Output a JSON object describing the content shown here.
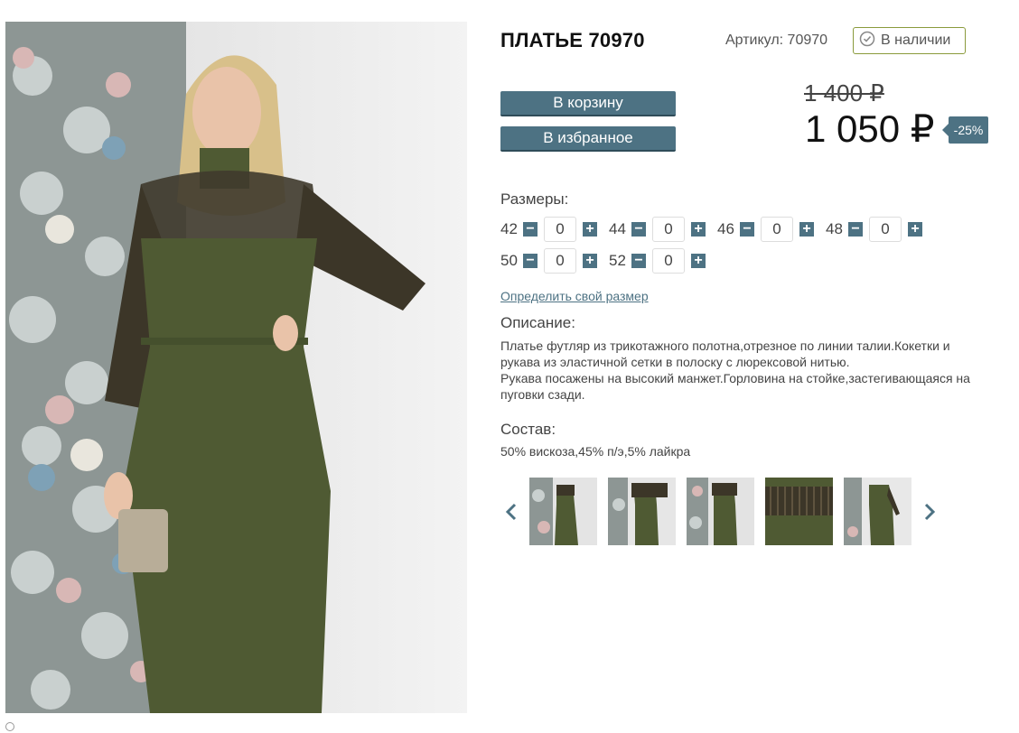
{
  "product": {
    "title": "ПЛАТЬЕ 70970",
    "sku_label": "Артикул: 70970",
    "stock_label": "В наличии",
    "old_price": "1 400 ₽",
    "price": "1 050 ₽",
    "discount": "-25%"
  },
  "actions": {
    "cart_label": "В корзину",
    "favorite_label": "В избранное"
  },
  "sizes": {
    "label": "Размеры:",
    "items": [
      {
        "size": "42",
        "qty": "0"
      },
      {
        "size": "44",
        "qty": "0"
      },
      {
        "size": "46",
        "qty": "0"
      },
      {
        "size": "48",
        "qty": "0"
      },
      {
        "size": "50",
        "qty": "0"
      },
      {
        "size": "52",
        "qty": "0"
      }
    ],
    "link_label": "Определить свой размер"
  },
  "description": {
    "label": "Описание:",
    "lines": [
      "Платье футляр из трикотажного полотна,отрезное по линии талии.Кокетки и рукава из эластичной сетки в полоску с люрексовой нитью.",
      "Рукава посажены на высокий манжет.Горловина на стойке,застегивающаяся на пуговки сзади."
    ]
  },
  "composition": {
    "label": "Состав:",
    "value": "50% вискоза,45% п/э,5% лайкра"
  },
  "gallery": {
    "thumb_count": 5,
    "prev_icon": "chevron-left-icon",
    "next_icon": "chevron-right-icon"
  },
  "colors": {
    "accent": "#4d7283",
    "stock_border": "#8a9a3c",
    "dress": "#4f5a33"
  }
}
